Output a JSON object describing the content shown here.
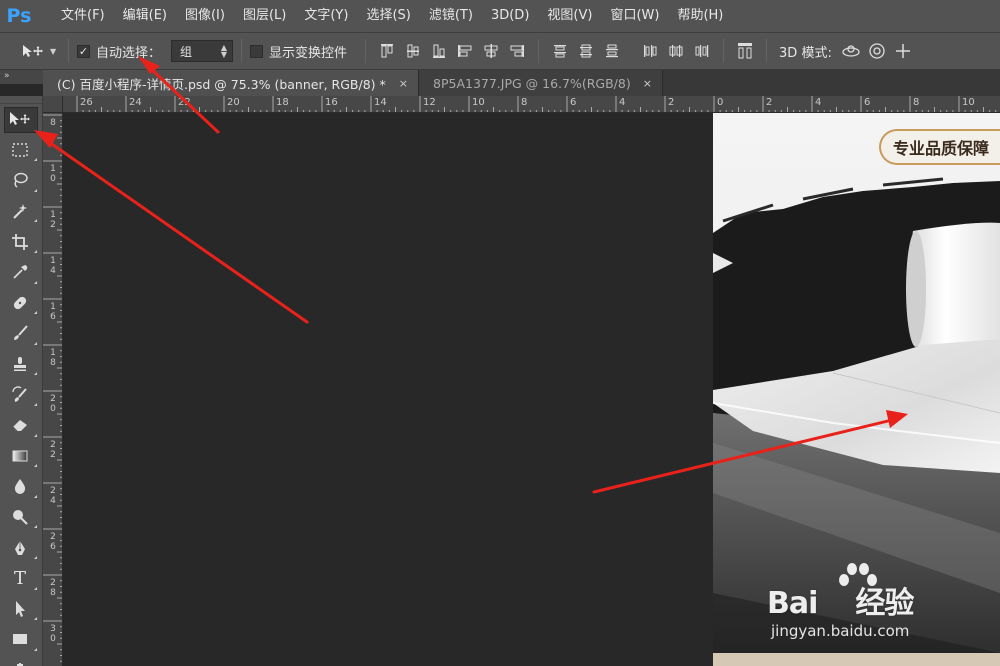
{
  "app": {
    "logo": "Ps"
  },
  "menu": [
    "文件(F)",
    "编辑(E)",
    "图像(I)",
    "图层(L)",
    "文字(Y)",
    "选择(S)",
    "滤镜(T)",
    "3D(D)",
    "视图(V)",
    "窗口(W)",
    "帮助(H)"
  ],
  "options": {
    "auto_select_label": "自动选择：",
    "auto_select_checked": true,
    "auto_select_target": "组",
    "show_transform_label": "显示变换控件",
    "show_transform_checked": false,
    "mode_3d_label": "3D 模式:"
  },
  "panel_toggle": "»",
  "tabs": [
    {
      "label": "(C) 百度小程序-详情页.psd @ 75.3% (banner, RGB/8) *",
      "active": true,
      "close": "×"
    },
    {
      "label": "8P5A1377.JPG @ 16.7%(RGB/8)",
      "active": false,
      "close": "×"
    }
  ],
  "tools": [
    "move-tool-icon",
    "marquee-tool-icon",
    "lasso-tool-icon",
    "magic-wand-icon",
    "crop-tool-icon",
    "eyedropper-icon",
    "healing-brush-icon",
    "brush-tool-icon",
    "clone-stamp-icon",
    "history-brush-icon",
    "eraser-icon",
    "gradient-tool-icon",
    "blur-tool-icon",
    "dodge-tool-icon",
    "pen-tool-icon",
    "type-tool-icon",
    "path-selection-icon",
    "rectangle-tool-icon",
    "hand-tool-icon"
  ],
  "type_tool_glyph": "T",
  "ruler": {
    "h_labels": [
      "26",
      "24",
      "22",
      "20",
      "18",
      "16",
      "14",
      "12",
      "10",
      "8",
      "6",
      "4",
      "2",
      "0",
      "2",
      "4",
      "6",
      "8",
      "10"
    ],
    "v_labels": [
      "8",
      "10",
      "12",
      "14",
      "16",
      "18",
      "20",
      "22",
      "24",
      "26",
      "28",
      "30",
      "32"
    ]
  },
  "document": {
    "badge_text": "专业品质保障"
  },
  "watermark": {
    "main": "Bai",
    "main2": "经验",
    "sub": "jingyan.baidu.com"
  },
  "colors": {
    "accent": "#3ba3ff",
    "annotation": "#e8221a"
  }
}
